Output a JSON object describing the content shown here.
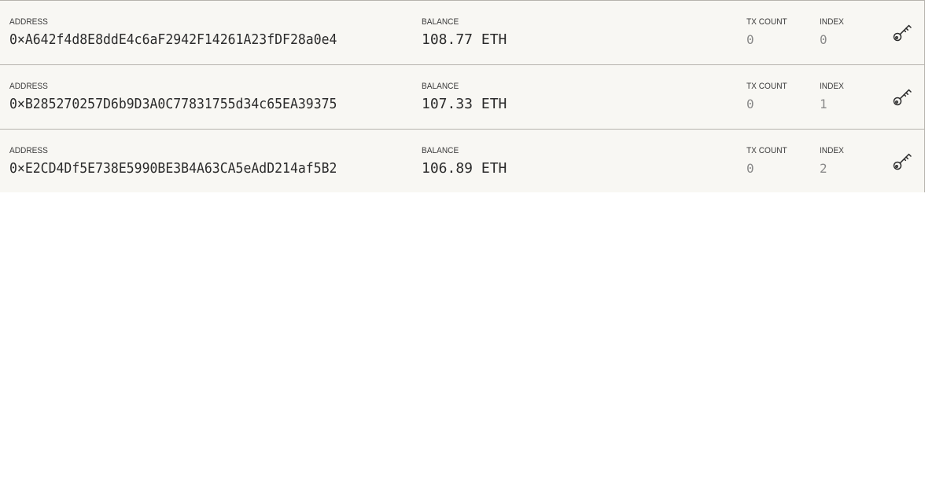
{
  "labels": {
    "address": "ADDRESS",
    "balance": "BALANCE",
    "tx_count": "TX COUNT",
    "index": "INDEX"
  },
  "accounts": [
    {
      "address": "0×A642f4d8E8ddE4c6aF2942F14261A23fDF28a0e4",
      "balance": "108.77 ETH",
      "tx_count": "0",
      "index": "0",
      "action_icon": "key-icon"
    },
    {
      "address": "0×B285270257D6b9D3A0C77831755d34c65EA39375",
      "balance": "107.33 ETH",
      "tx_count": "0",
      "index": "1",
      "action_icon": "key-icon"
    },
    {
      "address": "0×E2CD4Df5E738E5990BE3B4A63CA5eAdD214af5B2",
      "balance": "106.89 ETH",
      "tx_count": "0",
      "index": "2",
      "action_icon": "key-icon"
    }
  ],
  "colors": {
    "row_background": "#f8f7f3",
    "row_border": "#b6b3ad",
    "value_text": "#2b2b2b",
    "muted_text": "#8a8a8a"
  }
}
